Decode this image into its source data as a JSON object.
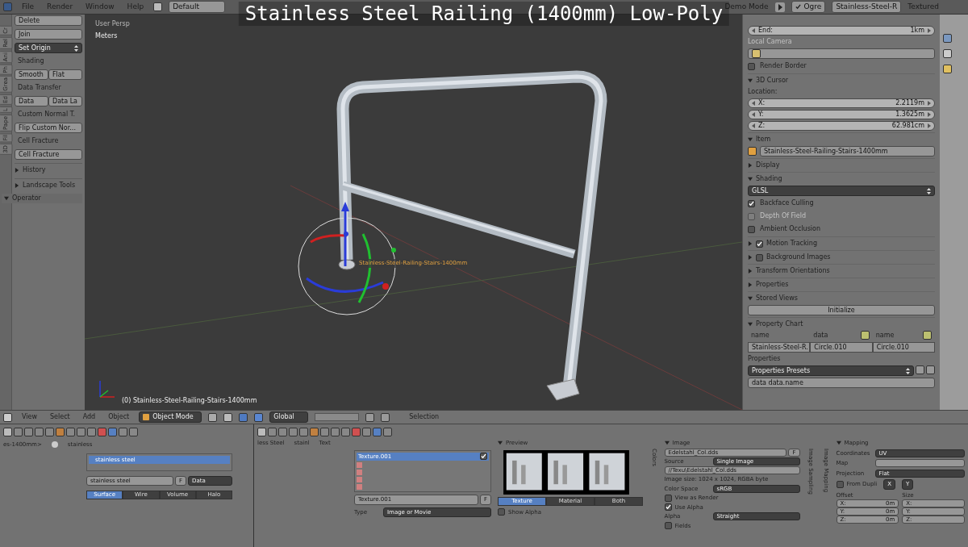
{
  "video_title": "Stainless Steel Railing (1400mm) Low-Poly",
  "top_bar": {
    "menus": [
      "File",
      "Render",
      "Window",
      "Help"
    ],
    "layout": "Default",
    "demo_mode": "Demo Mode",
    "engine": "Ogre",
    "scene": "Stainless-Steel-R",
    "shading": "Textured"
  },
  "tool_shelf": {
    "tabs": [
      "Cr",
      "Rel",
      "Ani",
      "Ph",
      "Grea",
      "Ed",
      "L",
      "Pape",
      "Fil",
      "3D"
    ],
    "items": [
      {
        "kind": "button",
        "label": "Delete"
      },
      {
        "kind": "button",
        "label": "Join"
      },
      {
        "kind": "dropdown",
        "label": "Set Origin"
      },
      {
        "kind": "heading",
        "label": "Shading"
      },
      {
        "kind": "pair",
        "labels": [
          "Smooth",
          "Flat"
        ]
      },
      {
        "kind": "heading",
        "label": "Data Transfer"
      },
      {
        "kind": "pair",
        "labels": [
          "Data",
          "Data La"
        ]
      },
      {
        "kind": "heading",
        "label": "Custom Normal T."
      },
      {
        "kind": "button",
        "label": "Flip Custom Nor..."
      },
      {
        "kind": "heading",
        "label": "Cell Fracture"
      },
      {
        "kind": "button",
        "label": "Cell Fracture"
      },
      {
        "kind": "section",
        "label": "History",
        "expanded": false
      },
      {
        "kind": "section",
        "label": "Landscape Tools",
        "expanded": false
      }
    ],
    "operator": {
      "label": "Operator",
      "expanded": true
    }
  },
  "viewport": {
    "view": "User Persp",
    "units": "Meters",
    "object_label": "Stainless-Steel-Railing-Stairs-1400mm",
    "status": "(0) Stainless-Steel-Railing-Stairs-1400mm"
  },
  "viewport_header": {
    "menus": [
      "View",
      "Select",
      "Add",
      "Object"
    ],
    "mode": "Object Mode",
    "orientation": "Global",
    "selection_label": "Selection"
  },
  "n_panel": [
    {
      "kind": "value",
      "label": "End:",
      "value": "1km"
    },
    {
      "kind": "label",
      "text": "Local Camera",
      "disabled": true
    },
    {
      "kind": "picker"
    },
    {
      "kind": "check",
      "label": "Render Border",
      "checked": false,
      "disabled": false
    },
    {
      "kind": "section",
      "label": "3D Cursor",
      "expanded": true
    },
    {
      "kind": "label",
      "text": "Location:",
      "disabled": false
    },
    {
      "kind": "value",
      "label": "X:",
      "value": "2.2119m"
    },
    {
      "kind": "value",
      "label": "Y:",
      "value": "1.3625m"
    },
    {
      "kind": "value",
      "label": "Z:",
      "value": "62.981cm"
    },
    {
      "kind": "section",
      "label": "Item",
      "expanded": true
    },
    {
      "kind": "name",
      "value": "Stainless-Steel-Railing-Stairs-1400mm"
    },
    {
      "kind": "section",
      "label": "Display",
      "expanded": false
    },
    {
      "kind": "section",
      "label": "Shading",
      "expanded": true
    },
    {
      "kind": "dropdown",
      "value": "GLSL"
    },
    {
      "kind": "check",
      "label": "Backface Culling",
      "checked": true,
      "disabled": false
    },
    {
      "kind": "check",
      "label": "Depth Of Field",
      "checked": false,
      "disabled": true
    },
    {
      "kind": "check",
      "label": "Ambient Occlusion",
      "checked": false,
      "disabled": false
    },
    {
      "kind": "section_check",
      "label": "Motion Tracking",
      "expanded": false,
      "checked": true
    },
    {
      "kind": "section_check",
      "label": "Background Images",
      "expanded": false,
      "checked": false
    },
    {
      "kind": "section",
      "label": "Transform Orientations",
      "expanded": false
    },
    {
      "kind": "section",
      "label": "Properties",
      "expanded": false
    },
    {
      "kind": "section",
      "label": "Stored Views",
      "expanded": true
    },
    {
      "kind": "button",
      "label": "Initialize"
    },
    {
      "kind": "section",
      "label": "Property Chart",
      "expanded": true
    },
    {
      "kind": "chart_table",
      "columns": [
        "name",
        "data",
        "name"
      ],
      "cells": [
        "Stainless-Steel-R.",
        "Circle.010",
        "Circle.010"
      ]
    },
    {
      "kind": "label",
      "text": "Properties",
      "disabled": false
    },
    {
      "kind": "preset",
      "value": "Properties Presets"
    },
    {
      "kind": "name",
      "value": "data data.name"
    }
  ],
  "material_panel": {
    "path": "es-1400mm>",
    "crumb": "stainless",
    "slot": "stainless steel",
    "material": "stainless steel",
    "users": "F",
    "link": "Data",
    "tabs": [
      {
        "label": "Surface",
        "selected": true
      },
      {
        "label": "Wire",
        "selected": false
      },
      {
        "label": "Volume",
        "selected": false
      },
      {
        "label": "Halo",
        "selected": false
      }
    ]
  },
  "texture_panel": {
    "crumbs": [
      "less Steel",
      "stainl",
      "Text"
    ],
    "slot": "Texture.001",
    "slot_enabled": true,
    "texture": "Texture.001",
    "users": "F",
    "type_label": "Type",
    "type": "Image or Movie"
  },
  "preview_panel": {
    "title": "Preview",
    "tabs": [
      {
        "label": "Texture",
        "selected": true
      },
      {
        "label": "Material",
        "selected": false
      },
      {
        "label": "Both",
        "selected": false
      }
    ],
    "show_alpha": {
      "label": "Show Alpha",
      "checked": false
    },
    "side_tab": "Colors"
  },
  "image_panel": {
    "title": "Image",
    "file": "Edelstahl_Col.dds",
    "users": "F",
    "source_label": "Source",
    "source": "Single Image",
    "path": "//Texu\\Edelstahl_Col.dds",
    "info": "Image size: 1024 x 1024, RGBA byte",
    "color_space_label": "Color Space",
    "color_space": "sRGB",
    "checks": [
      {
        "label": "View as Render",
        "checked": false
      },
      {
        "label": "Use Alpha",
        "checked": true
      }
    ],
    "alpha_label": "Alpha",
    "alpha": "Straight",
    "fields": {
      "label": "Fields",
      "checked": false
    },
    "side_tabs": [
      "Image Sampling",
      "Image Mapping"
    ]
  },
  "mapping_panel": {
    "title": "Mapping",
    "coordinates_label": "Coordinates",
    "coordinates": "UV",
    "map_label": "Map",
    "projection_label": "Projection",
    "projection": "Flat",
    "from_dupli": {
      "label": "From Dupli",
      "checked": false
    },
    "axes": [
      "X",
      "Y"
    ],
    "offset_label": "Offset",
    "offset": [
      {
        "label": "X:",
        "value": "0m"
      },
      {
        "label": "Y:",
        "value": "0m"
      },
      {
        "label": "Z:",
        "value": "0m"
      }
    ],
    "size_label": "Size",
    "size": [
      "X:",
      "Y:",
      "Z:"
    ]
  }
}
